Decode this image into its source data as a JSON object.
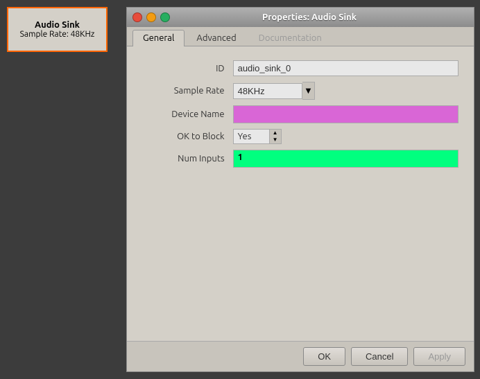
{
  "block_widget": {
    "title": "Audio Sink",
    "subtitle_label": "Sample Rate:",
    "subtitle_value": "48KHz"
  },
  "dialog": {
    "title": "Properties: Audio Sink",
    "tabs": [
      {
        "label": "General",
        "active": true,
        "disabled": false
      },
      {
        "label": "Advanced",
        "active": false,
        "disabled": false
      },
      {
        "label": "Documentation",
        "active": false,
        "disabled": true
      }
    ],
    "form": {
      "id_label": "ID",
      "id_value": "audio_sink_0",
      "sample_rate_label": "Sample Rate",
      "sample_rate_value": "48KHz",
      "device_name_label": "Device Name",
      "ok_to_block_label": "OK to Block",
      "ok_to_block_value": "Yes",
      "num_inputs_label": "Num Inputs",
      "num_inputs_value": "1"
    },
    "buttons": {
      "ok": "OK",
      "cancel": "Cancel",
      "apply": "Apply"
    }
  }
}
